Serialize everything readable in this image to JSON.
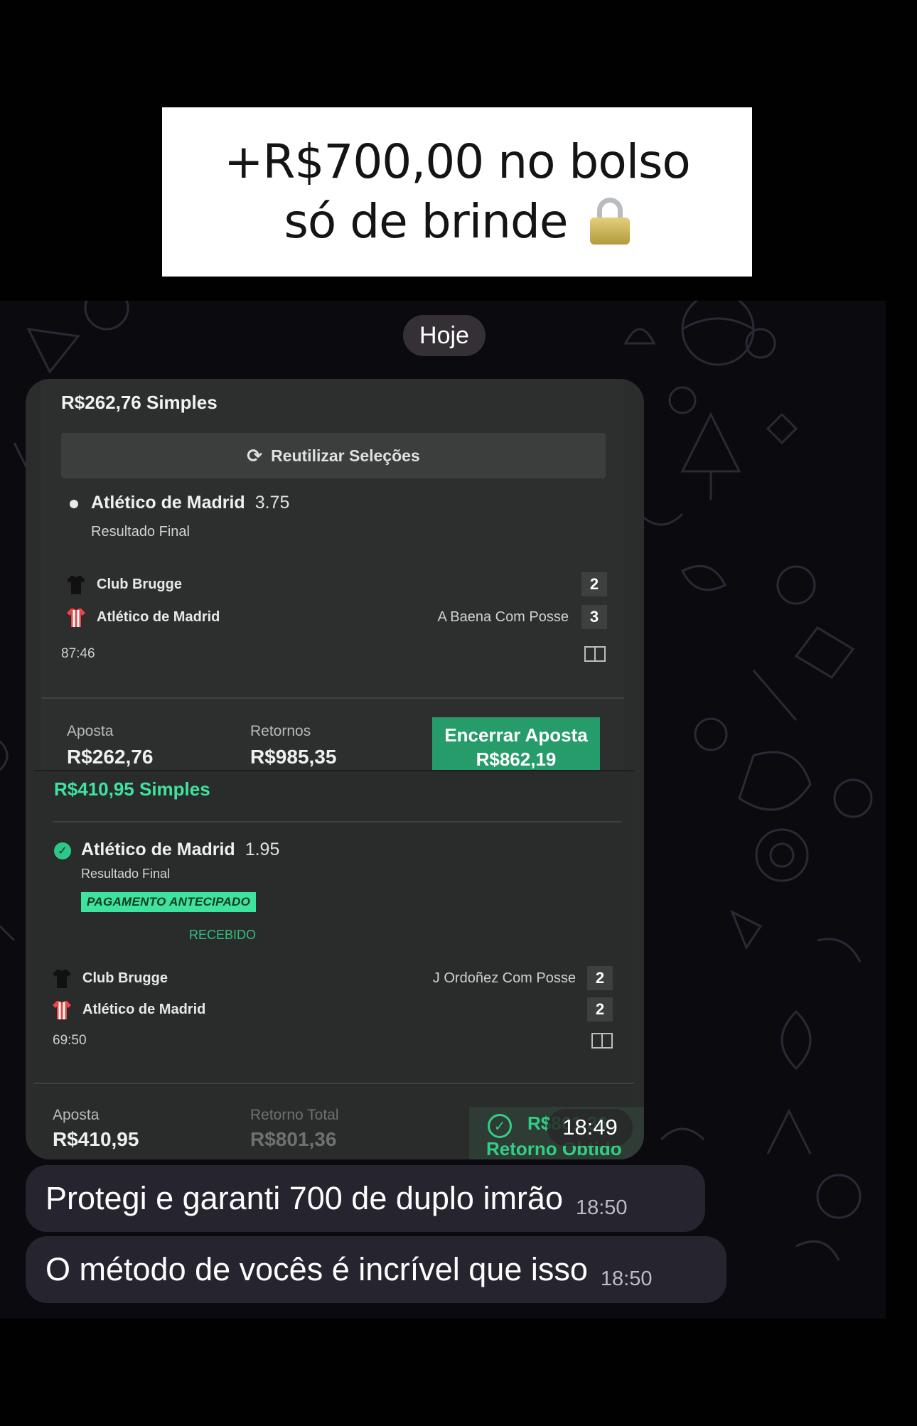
{
  "caption": {
    "line1": "+R$700,00 no bolso",
    "line2": "só de brinde",
    "emoji": "lock-icon"
  },
  "chat": {
    "date_label": "Hoje",
    "image_time": "18:49",
    "messages": [
      {
        "text": "Protegi e garanti 700 de duplo imrão",
        "time": "18:50"
      },
      {
        "text": "O método de vocês é incrível que isso",
        "time": "18:50"
      }
    ]
  },
  "slip1": {
    "title": "R$262,76  Simples",
    "reuse_label": "Reutilizar Seleções",
    "selection": "Atlético de Madrid",
    "odds": "3.75",
    "market": "Resultado Final",
    "team1": "Club Brugge",
    "team1_score": "2",
    "team2": "Atlético de Madrid",
    "team2_score": "3",
    "possession": "A Baena Com Posse",
    "clock": "87:46",
    "stake_label": "Aposta",
    "stake_value": "R$262,76",
    "returns_label": "Retornos",
    "returns_value": "R$985,35",
    "cashout_label": "Encerrar Aposta",
    "cashout_value": "R$862,19",
    "colors": {
      "cashout": "#269c6a"
    }
  },
  "slip2": {
    "title": "R$410,95 Simples",
    "selection": "Atlético de Madrid",
    "odds": "1.95",
    "market": "Resultado Final",
    "badge": "PAGAMENTO ANTECIPADO",
    "received": "RECEBIDO",
    "team1": "Club Brugge",
    "team1_score": "2",
    "team2": "Atlético de Madrid",
    "team2_score": "2",
    "possession": "J Ordoñez Com Posse",
    "clock": "69:50",
    "stake_label": "Aposta",
    "stake_value": "R$410,95",
    "total_label": "Retorno Total",
    "total_value": "R$801,36",
    "returned_amount": "R$801,36",
    "returned_label": "Retorno Obtido",
    "colors": {
      "title": "#3fe3a0",
      "badge": "#3fe3a0",
      "returned": "#31cf86"
    }
  }
}
